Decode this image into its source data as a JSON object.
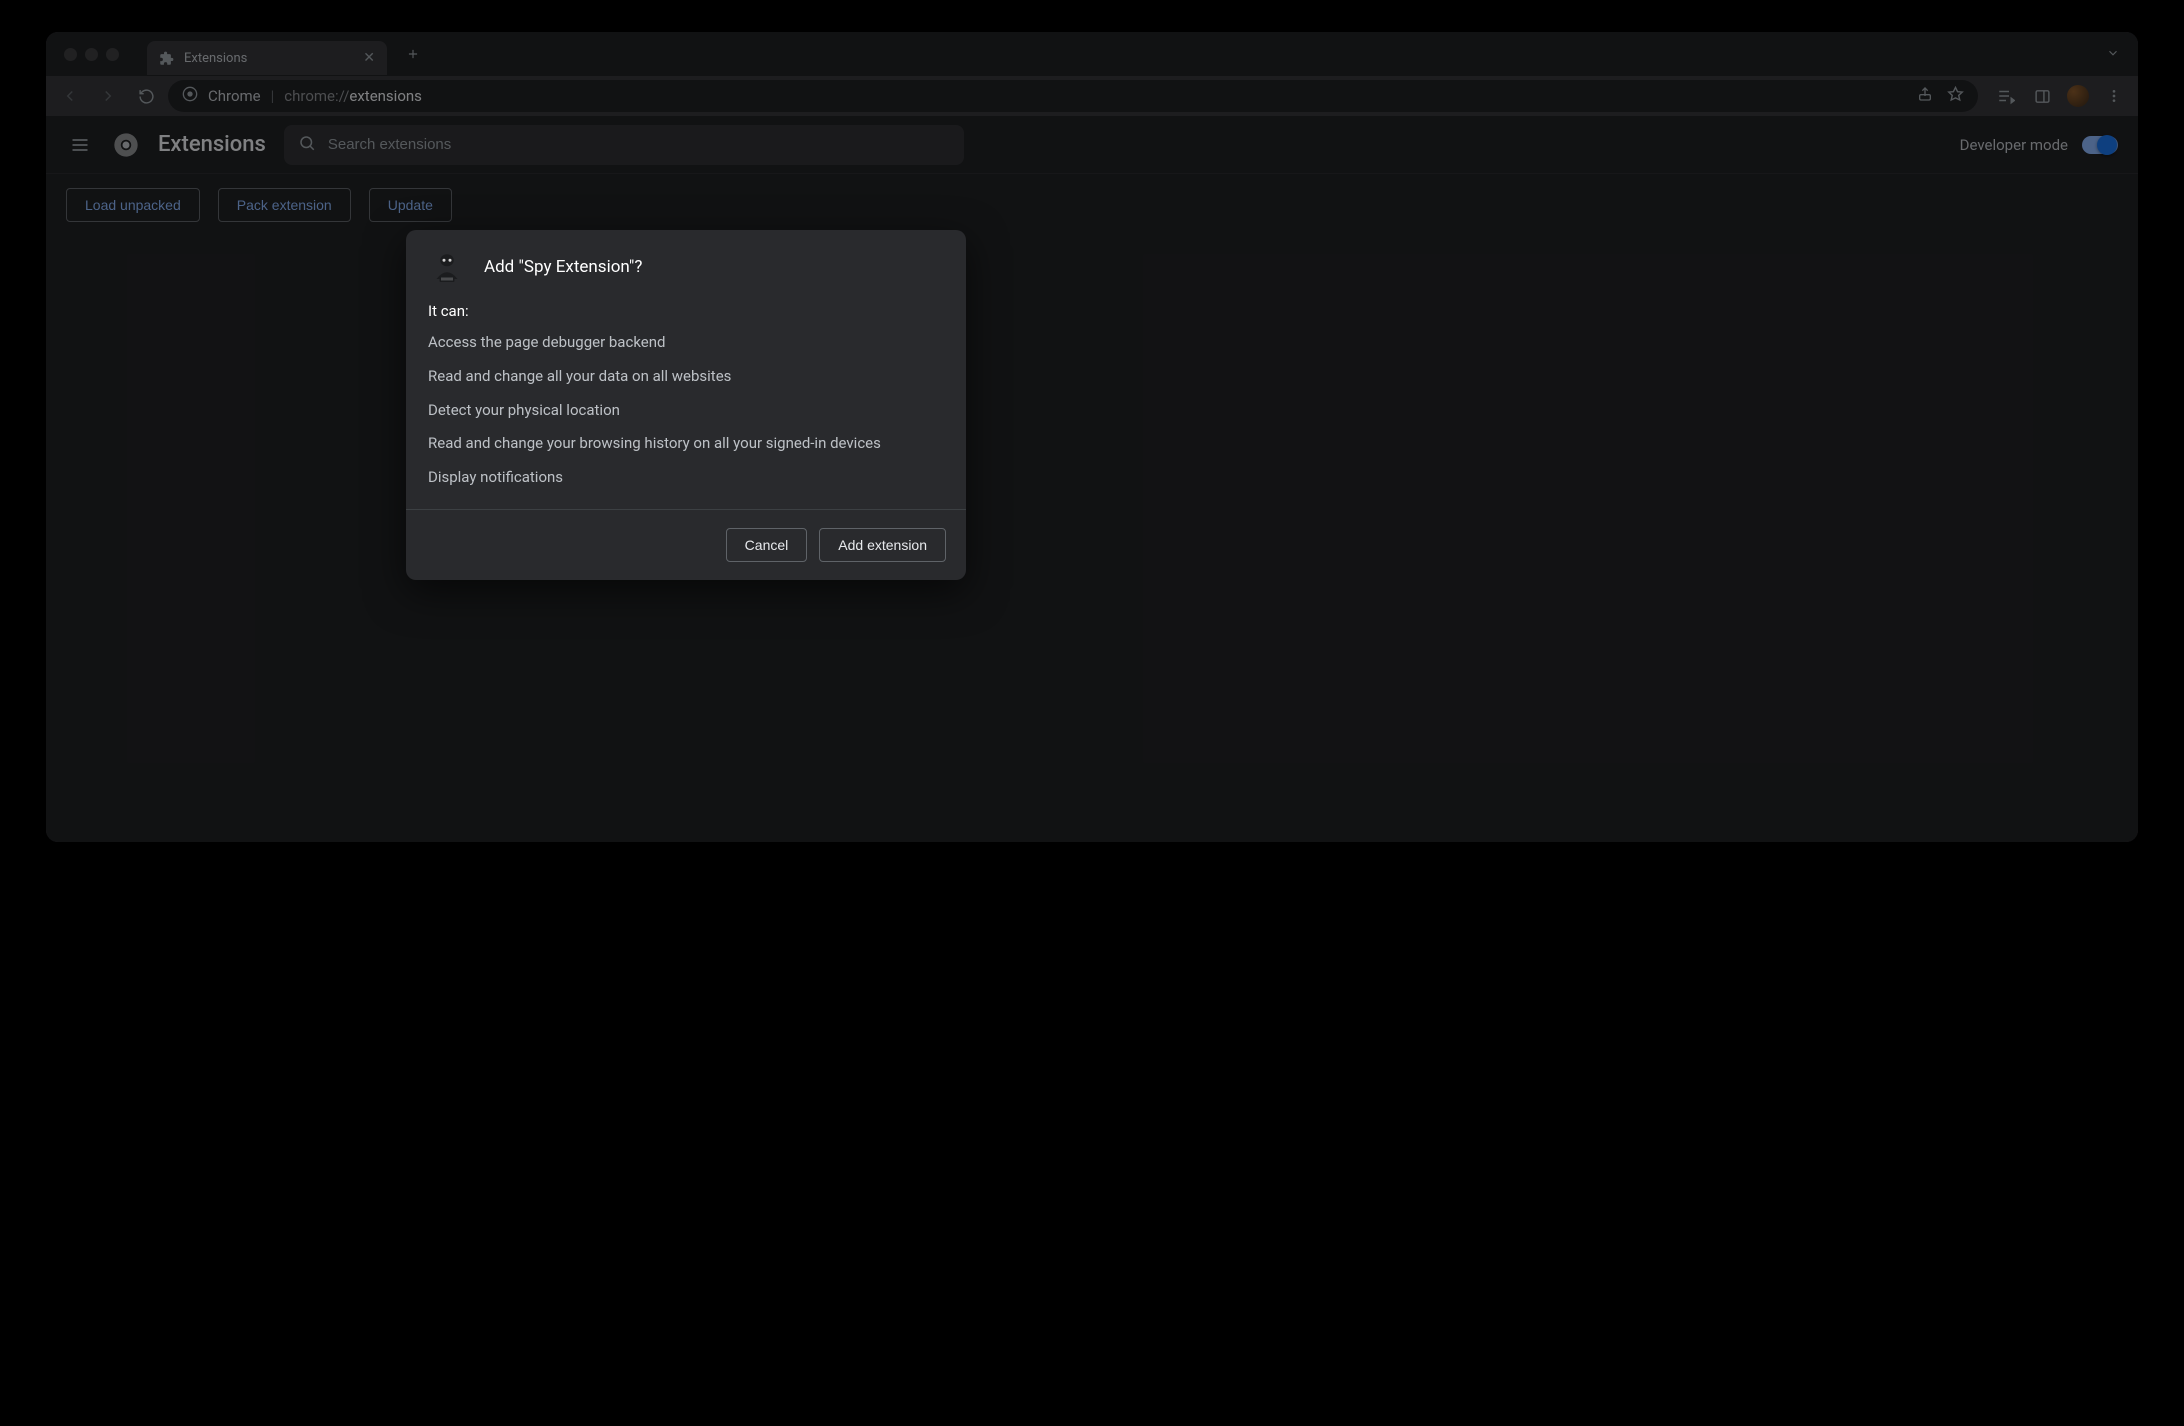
{
  "tab": {
    "title": "Extensions"
  },
  "omnibox": {
    "product": "Chrome",
    "url_prefix": "chrome://",
    "url_path": "extensions"
  },
  "appbar": {
    "title": "Extensions",
    "search_placeholder": "Search extensions",
    "dev_mode_label": "Developer mode"
  },
  "actions": {
    "load_unpacked": "Load unpacked",
    "pack_extension": "Pack extension",
    "update": "Update"
  },
  "dialog": {
    "title": "Add \"Spy Extension\"?",
    "it_can": "It can:",
    "permissions": [
      "Access the page debugger backend",
      "Read and change all your data on all websites",
      "Detect your physical location",
      "Read and change your browsing history on all your signed-in devices",
      "Display notifications"
    ],
    "cancel": "Cancel",
    "confirm": "Add extension"
  }
}
